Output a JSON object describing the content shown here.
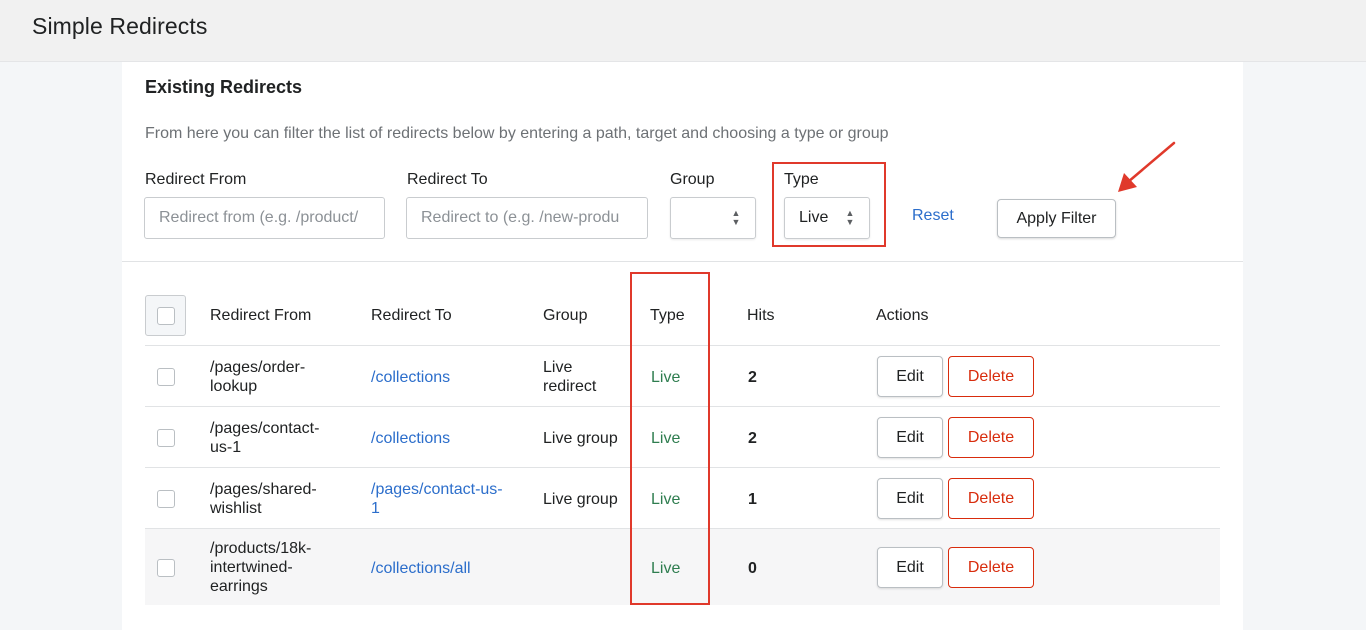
{
  "app": {
    "title": "Simple Redirects"
  },
  "card": {
    "title": "Existing Redirects",
    "description": "From here you can filter the list of redirects below by entering a path, target and choosing a type or group"
  },
  "filters": {
    "from_label": "Redirect From",
    "from_placeholder": "Redirect from (e.g. /product/",
    "to_label": "Redirect To",
    "to_placeholder": "Redirect to (e.g. /new-produ",
    "group_label": "Group",
    "group_value": "",
    "type_label": "Type",
    "type_value": "Live",
    "reset_label": "Reset",
    "apply_label": "Apply Filter"
  },
  "table": {
    "columns": [
      "Redirect From",
      "Redirect To",
      "Group",
      "Type",
      "Hits",
      "Actions"
    ],
    "edit_label": "Edit",
    "delete_label": "Delete",
    "rows": [
      {
        "from": [
          "/pages/order-",
          "lookup"
        ],
        "to": [
          "/collections"
        ],
        "group": [
          "Live",
          "redirect"
        ],
        "type": "Live",
        "hits": "2"
      },
      {
        "from": [
          "/pages/contact-",
          "us-1"
        ],
        "to": [
          "/collections"
        ],
        "group": [
          "Live group"
        ],
        "type": "Live",
        "hits": "2"
      },
      {
        "from": [
          "/pages/shared-",
          "wishlist"
        ],
        "to": [
          "/pages/contact-us-",
          "1"
        ],
        "group": [
          "Live group"
        ],
        "type": "Live",
        "hits": "1"
      },
      {
        "from": [
          "/products/18k-",
          "intertwined-",
          "earrings"
        ],
        "to": [
          "/collections/all"
        ],
        "group": [],
        "type": "Live",
        "hits": "0"
      }
    ]
  },
  "colors": {
    "link": "#2c6ecb",
    "live": "#2e7d4f",
    "delete": "#d82c0d",
    "annotation": "#e0392b"
  },
  "icons": [
    "select-chevron-icon",
    "annotation-arrow-icon"
  ]
}
